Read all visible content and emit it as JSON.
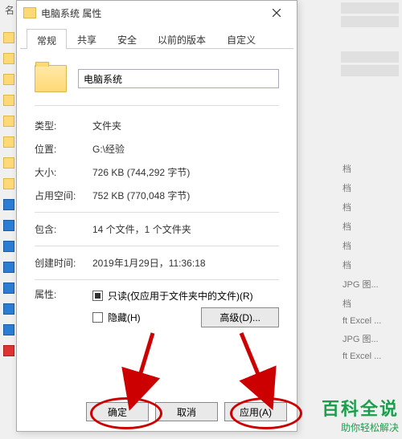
{
  "bg": {
    "col_name": "名",
    "files": [
      "档",
      "档",
      "档",
      "档",
      "档",
      "档",
      "JPG 图...",
      "档",
      "ft Excel ...",
      "JPG 图...",
      "ft Excel ..."
    ]
  },
  "dialog": {
    "title": "电脑系统 属性",
    "tabs": [
      "常规",
      "共享",
      "安全",
      "以前的版本",
      "自定义"
    ],
    "active_tab": 0,
    "name_value": "电脑系统",
    "rows": {
      "type_label": "类型:",
      "type_value": "文件夹",
      "location_label": "位置:",
      "location_value": "G:\\经验",
      "size_label": "大小:",
      "size_value": "726 KB (744,292 字节)",
      "disk_label": "占用空间:",
      "disk_value": "752 KB (770,048 字节)",
      "contains_label": "包含:",
      "contains_value": "14 个文件，1 个文件夹",
      "created_label": "创建时间:",
      "created_value": "2019年1月29日，11:36:18",
      "attr_label": "属性:",
      "readonly_label": "只读(仅应用于文件夹中的文件)(R)",
      "hidden_label": "隐藏(H)",
      "advanced_label": "高级(D)..."
    },
    "buttons": {
      "ok": "确定",
      "cancel": "取消",
      "apply": "应用(A)"
    }
  },
  "watermark": {
    "big": "百科全说",
    "small": "助你轻松解决"
  }
}
